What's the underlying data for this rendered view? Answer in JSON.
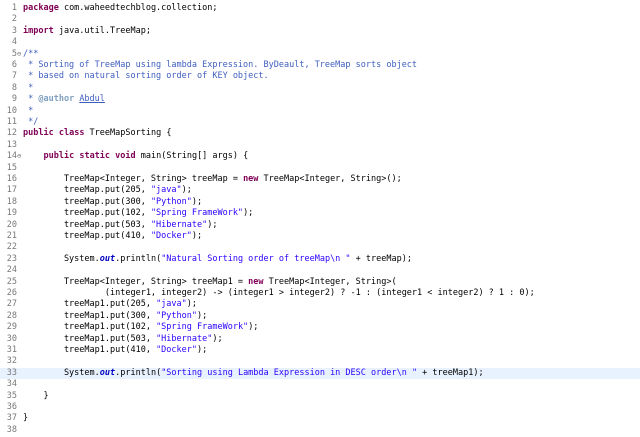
{
  "editor": {
    "current_line": 33,
    "lines": [
      {
        "n": "1",
        "fold": "",
        "tokens": [
          {
            "t": "package",
            "c": "kw"
          },
          {
            "t": " com.waheedtechblog.collection;"
          }
        ]
      },
      {
        "n": "2",
        "fold": "",
        "tokens": []
      },
      {
        "n": "3",
        "fold": "",
        "tokens": [
          {
            "t": "import",
            "c": "kw"
          },
          {
            "t": " java.util.TreeMap;"
          }
        ]
      },
      {
        "n": "4",
        "fold": "",
        "tokens": []
      },
      {
        "n": "5",
        "fold": "⊖",
        "tokens": [
          {
            "t": "/**",
            "c": "cmt"
          }
        ]
      },
      {
        "n": "6",
        "fold": "",
        "tokens": [
          {
            "t": " * Sorting of TreeMap using lambda Expression. ByDeault, TreeMap sorts object",
            "c": "cmt"
          }
        ]
      },
      {
        "n": "7",
        "fold": "",
        "tokens": [
          {
            "t": " * based on natural sorting order of KEY object.",
            "c": "cmt"
          }
        ]
      },
      {
        "n": "8",
        "fold": "",
        "tokens": [
          {
            "t": " *",
            "c": "cmt"
          }
        ]
      },
      {
        "n": "9",
        "fold": "",
        "tokens": [
          {
            "t": " * ",
            "c": "cmt"
          },
          {
            "t": "@author",
            "c": "tag"
          },
          {
            "t": " ",
            "c": "cmt"
          },
          {
            "t": "Abdul",
            "c": "cmt ul"
          }
        ]
      },
      {
        "n": "10",
        "fold": "",
        "tokens": [
          {
            "t": " *",
            "c": "cmt"
          }
        ]
      },
      {
        "n": "11",
        "fold": "",
        "tokens": [
          {
            "t": " */",
            "c": "cmt"
          }
        ]
      },
      {
        "n": "12",
        "fold": "",
        "tokens": [
          {
            "t": "public",
            "c": "kw"
          },
          {
            "t": " "
          },
          {
            "t": "class",
            "c": "kw"
          },
          {
            "t": " TreeMapSorting {"
          }
        ]
      },
      {
        "n": "13",
        "fold": "",
        "tokens": []
      },
      {
        "n": "14",
        "fold": "⊖",
        "tokens": [
          {
            "t": "    "
          },
          {
            "t": "public",
            "c": "kw"
          },
          {
            "t": " "
          },
          {
            "t": "static",
            "c": "kw"
          },
          {
            "t": " "
          },
          {
            "t": "void",
            "c": "kw"
          },
          {
            "t": " main(String[] args) {"
          }
        ]
      },
      {
        "n": "15",
        "fold": "",
        "tokens": []
      },
      {
        "n": "16",
        "fold": "",
        "tokens": [
          {
            "t": "        TreeMap<Integer, String> treeMap = "
          },
          {
            "t": "new",
            "c": "kw"
          },
          {
            "t": " TreeMap<Integer, String>();"
          }
        ]
      },
      {
        "n": "17",
        "fold": "",
        "tokens": [
          {
            "t": "        treeMap.put(205, "
          },
          {
            "t": "\"java\"",
            "c": "str"
          },
          {
            "t": ");"
          }
        ]
      },
      {
        "n": "18",
        "fold": "",
        "tokens": [
          {
            "t": "        treeMap.put(300, "
          },
          {
            "t": "\"Python\"",
            "c": "str"
          },
          {
            "t": ");"
          }
        ]
      },
      {
        "n": "19",
        "fold": "",
        "tokens": [
          {
            "t": "        treeMap.put(102, "
          },
          {
            "t": "\"Spring FrameWork\"",
            "c": "str"
          },
          {
            "t": ");"
          }
        ]
      },
      {
        "n": "20",
        "fold": "",
        "tokens": [
          {
            "t": "        treeMap.put(503, "
          },
          {
            "t": "\"Hibernate\"",
            "c": "str"
          },
          {
            "t": ");"
          }
        ]
      },
      {
        "n": "21",
        "fold": "",
        "tokens": [
          {
            "t": "        treeMap.put(410, "
          },
          {
            "t": "\"Docker\"",
            "c": "str"
          },
          {
            "t": ");"
          }
        ]
      },
      {
        "n": "22",
        "fold": "",
        "tokens": []
      },
      {
        "n": "23",
        "fold": "",
        "tokens": [
          {
            "t": "        System."
          },
          {
            "t": "out",
            "c": "fld"
          },
          {
            "t": ".println("
          },
          {
            "t": "\"Natural Sorting order of treeMap\\n \"",
            "c": "str"
          },
          {
            "t": " + treeMap);"
          }
        ]
      },
      {
        "n": "24",
        "fold": "",
        "tokens": []
      },
      {
        "n": "25",
        "fold": "",
        "tokens": [
          {
            "t": "        TreeMap<Integer, String> treeMap1 = "
          },
          {
            "t": "new",
            "c": "kw"
          },
          {
            "t": " TreeMap<Integer, String>("
          }
        ]
      },
      {
        "n": "26",
        "fold": "",
        "tokens": [
          {
            "t": "                (integer1, integer2) -> (integer1 > integer2) ? -1 : (integer1 < integer2) ? 1 : 0);"
          }
        ]
      },
      {
        "n": "27",
        "fold": "",
        "tokens": [
          {
            "t": "        treeMap1.put(205, "
          },
          {
            "t": "\"java\"",
            "c": "str"
          },
          {
            "t": ");"
          }
        ]
      },
      {
        "n": "28",
        "fold": "",
        "tokens": [
          {
            "t": "        treeMap1.put(300, "
          },
          {
            "t": "\"Python\"",
            "c": "str"
          },
          {
            "t": ");"
          }
        ]
      },
      {
        "n": "29",
        "fold": "",
        "tokens": [
          {
            "t": "        treeMap1.put(102, "
          },
          {
            "t": "\"Spring FrameWork\"",
            "c": "str"
          },
          {
            "t": ");"
          }
        ]
      },
      {
        "n": "30",
        "fold": "",
        "tokens": [
          {
            "t": "        treeMap1.put(503, "
          },
          {
            "t": "\"Hibernate\"",
            "c": "str"
          },
          {
            "t": ");"
          }
        ]
      },
      {
        "n": "31",
        "fold": "",
        "tokens": [
          {
            "t": "        treeMap1.put(410, "
          },
          {
            "t": "\"Docker\"",
            "c": "str"
          },
          {
            "t": ");"
          }
        ]
      },
      {
        "n": "32",
        "fold": "",
        "tokens": []
      },
      {
        "n": "33",
        "fold": "",
        "tokens": [
          {
            "t": "        System."
          },
          {
            "t": "out",
            "c": "fld"
          },
          {
            "t": ".println("
          },
          {
            "t": "\"Sorting using Lambda Expression in DESC order\\n \"",
            "c": "str"
          },
          {
            "t": " + treeMap1);"
          }
        ]
      },
      {
        "n": "34",
        "fold": "",
        "tokens": []
      },
      {
        "n": "35",
        "fold": "",
        "tokens": [
          {
            "t": "    }"
          }
        ]
      },
      {
        "n": "36",
        "fold": "",
        "tokens": []
      },
      {
        "n": "37",
        "fold": "",
        "tokens": [
          {
            "t": "}"
          }
        ]
      },
      {
        "n": "38",
        "fold": "",
        "tokens": []
      }
    ]
  }
}
